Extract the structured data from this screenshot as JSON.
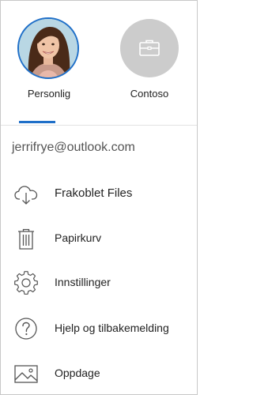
{
  "accounts": [
    {
      "label": "Personlig",
      "active": true
    },
    {
      "label": "Contoso",
      "active": false
    }
  ],
  "user": {
    "email": "jerrifrye@outlook.com"
  },
  "menu": {
    "items": [
      {
        "label": "Frakoblet Files",
        "icon": "cloud-download-icon"
      },
      {
        "label": "Papirkurv",
        "icon": "trash-icon"
      },
      {
        "label": "Innstillinger",
        "icon": "gear-icon"
      },
      {
        "label": "Hjelp og tilbakemelding",
        "icon": "help-icon"
      },
      {
        "label": "Oppdage",
        "icon": "image-icon"
      }
    ]
  },
  "colors": {
    "accent": "#1f6fc8",
    "work_avatar_bg": "#cccccc",
    "icon_stroke": "#555555"
  }
}
